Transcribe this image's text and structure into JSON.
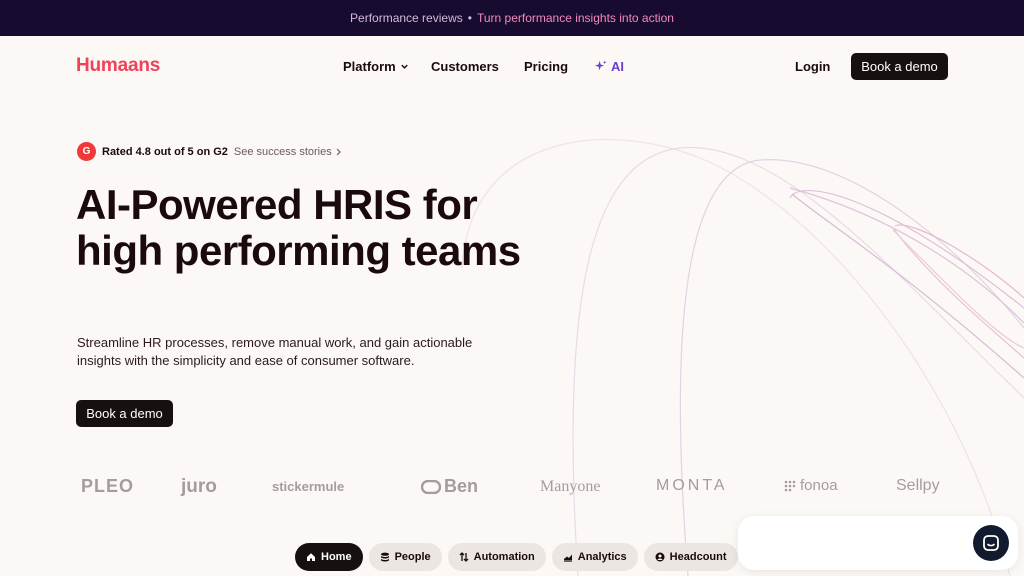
{
  "banner": {
    "left": "Performance reviews",
    "sep": "•",
    "right": "Turn performance insights into action"
  },
  "header": {
    "logo": "Humaans",
    "nav": [
      {
        "label": "Platform"
      },
      {
        "label": "Customers"
      },
      {
        "label": "Pricing"
      },
      {
        "label": "AI"
      }
    ],
    "login": "Login",
    "cta": "Book a demo"
  },
  "hero": {
    "badge": "G",
    "rating": "Rated 4.8 out of 5 on G2",
    "stories": "See success stories",
    "title": "AI-Powered HRIS for high performing teams",
    "subtitle": "Streamline HR processes, remove manual work, and gain actionable insights with the simplicity and ease of consumer software.",
    "cta": "Book a demo"
  },
  "logos": [
    "PLEO",
    "juro",
    "stickermule",
    "Ben",
    "Manyone",
    "MONTA",
    "fonoa",
    "Sellpy"
  ],
  "tabs": [
    {
      "label": "Home",
      "icon": "home-icon"
    },
    {
      "label": "People",
      "icon": "database-icon"
    },
    {
      "label": "Automation",
      "icon": "arrows-icon"
    },
    {
      "label": "Analytics",
      "icon": "chart-icon"
    },
    {
      "label": "Headcount",
      "icon": "user-circle-icon"
    }
  ],
  "colors": {
    "brand": "#f0415a",
    "banner_bg": "#170b30",
    "ai_accent": "#6b3fd0",
    "dark_button": "#161010"
  }
}
